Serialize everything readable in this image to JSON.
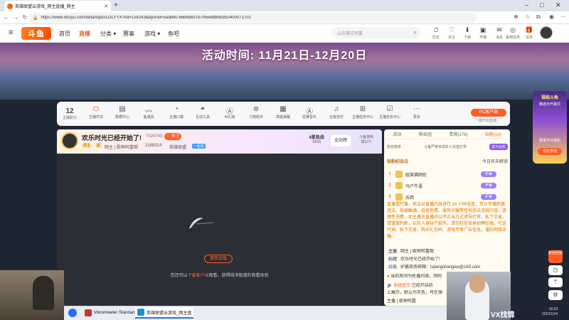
{
  "browser": {
    "tab_title": "英雄联盟云游戏_网主直播_网主",
    "url": "https://www.douyu.com/beta/topic/LOLYYX?rid=138243&dyshid=5adb4c-66b6d837b7f45efdbfdc850400071701"
  },
  "header": {
    "logo": "斗鱼",
    "nav": [
      "首页",
      "直播",
      "分类",
      "赛事",
      "游戏",
      "鱼吧"
    ],
    "search_placeholder": "山东棋王阿蒙",
    "icons": [
      {
        "icon": "history-icon",
        "label": "历史"
      },
      {
        "icon": "follow-icon",
        "label": "关注"
      },
      {
        "icon": "download-icon",
        "label": "下载"
      },
      {
        "icon": "broadcast-icon",
        "label": "开播"
      },
      {
        "icon": "message-icon",
        "label": "消息"
      },
      {
        "icon": "mission-icon",
        "label": "鱼吧任务"
      },
      {
        "icon": "task-icon",
        "label": "任务"
      }
    ]
  },
  "banner": {
    "text": "活动时间: 11月21日-12月20日"
  },
  "toolbar": {
    "level": "12",
    "level_label": "主播积分",
    "items": [
      "主播开关",
      "数据中心",
      "鱼语段",
      "主播口袋",
      "互动工具",
      "AI礼物",
      "刀塔助手",
      "高能弹幕",
      "星推音乐",
      "正版音乐",
      "主播任务中心",
      "更多"
    ],
    "pc_button": "PC客户端",
    "pc_sub": "一键开启直播"
  },
  "room": {
    "title": "欢乐时光已经开始了!",
    "id": "7026749",
    "follow": "关注",
    "badge1": "周主",
    "badge2": "超",
    "meta": "网主 | 歌神阿嘉哦",
    "fans": "2188314",
    "category": "英雄联盟",
    "tag": "一起看",
    "rank_label": "4星热战",
    "rank_value": "14/15",
    "all_station": "全站榜",
    "game_label": "斗鱼游戏",
    "game_value": "领10个"
  },
  "video": {
    "reload": "重新加载",
    "tip_prefix": "您还可以",
    "tip_link": "下载客户端",
    "tip_suffix": "观看，获得纯净极速的观看体验"
  },
  "chat": {
    "tabs": [
      "活动",
      "粉丝团",
      "贵宾(178)",
      "钻粉(14)"
    ],
    "fan_text": "粉丝榜单",
    "fan_hint": "斗鱼严禁未成年人充值打赏",
    "fan_btn": "成为钻粉",
    "rank_title": "钻粉纪念日",
    "rank_hint": "今日有未解锁",
    "rank_rows": [
      {
        "no": "1",
        "name": "姐菜佛网伦",
        "tag": "铲兼"
      },
      {
        "no": "2",
        "name": "马户牛逼",
        "tag": "铲兼"
      },
      {
        "no": "3",
        "name": "苏西",
        "tag": "铲兼"
      }
    ],
    "notice": "直播倡打黄，依法对直播内容进行 24 小时巡查，禁止传播刺激违法、吸烟酗酒、低俗色情、服饰诈骗等任何违法违规内容。请理性消费，如主播在直播间以不正当方式诱导打赏、私下交易，请谨慎判断，以防人身财产损失。请勿轻信各类招聘征婚、代送代抽、私下交易、购买礼包码、游戏币等广告信息，谨防网络诈骗。",
    "lines": [
      {
        "label": "主播",
        "text": "网主 | 歌神阿嘉哦"
      },
      {
        "label": "标题",
        "text": "欢乐时光已经开始了!"
      },
      {
        "label": "公告",
        "text": "驴酱商务邮箱：lvjiangshangwu@163.com"
      },
      {
        "label": "",
        "text": "当前房间为轮播内容，同时"
      },
      {
        "label": "系统提示",
        "text": "已经开启防"
      },
      {
        "label": "",
        "text": "上展示，默认为灰色，可在弹"
      },
      {
        "label": "",
        "text": "主播 | 歌神阿嘉"
      }
    ]
  },
  "side_ad": {
    "title": "福临斗鱼",
    "sub": "精选日开幕式",
    "cta": "现在参加",
    "name": "赛事节日钱包"
  },
  "float": {
    "label": "粉丝回馈"
  },
  "taskbar": {
    "apps": [
      "Voicemeeter Standard",
      "英雄联盟云游戏_网主直"
    ],
    "time": "16:53",
    "date": "2023/12/4"
  },
  "watermark": "VX找锦"
}
